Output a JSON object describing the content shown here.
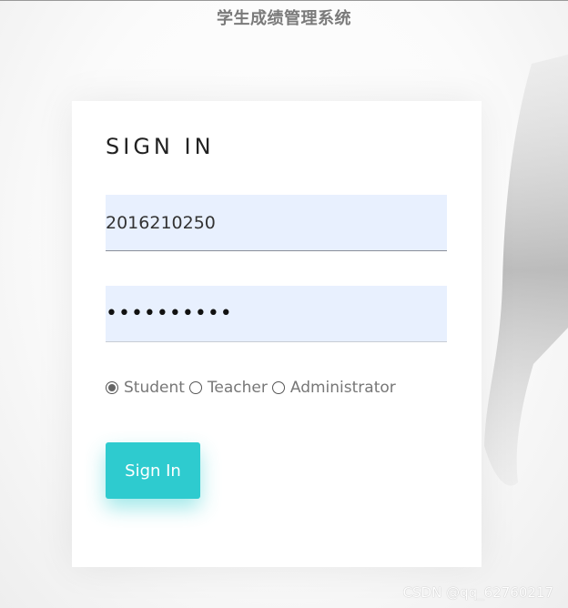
{
  "header": {
    "title": "学生成绩管理系统"
  },
  "login": {
    "heading": "SIGN IN",
    "username_value": "2016210250",
    "password_value": "••••••••••",
    "roles": [
      {
        "label": "Student",
        "checked": true
      },
      {
        "label": "Teacher",
        "checked": false
      },
      {
        "label": "Administrator",
        "checked": false
      }
    ],
    "submit_label": "Sign In"
  },
  "watermark": "CSDN @qq_62760217",
  "colors": {
    "accent": "#2ecbcf",
    "field_bg": "#e8f0fe"
  }
}
